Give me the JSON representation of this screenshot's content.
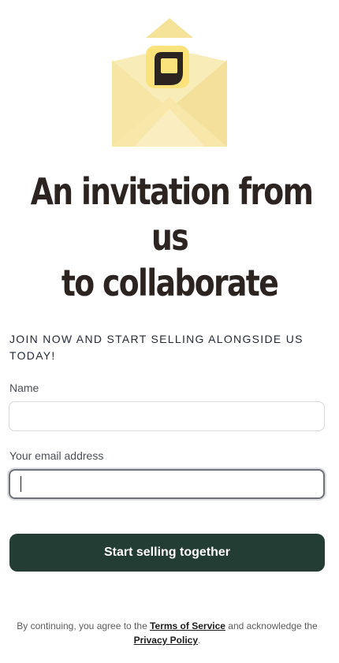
{
  "hero": {
    "icon": "envelope-with-logo-icon",
    "colors": {
      "envelope_light": "#f8eab4",
      "envelope_mid": "#f4e29a",
      "envelope_flap": "#f0dc8c",
      "logo_bg": "#fbe27a",
      "logo_mark": "#2b2421",
      "logo_square": "#fbe27a"
    }
  },
  "headline": {
    "line1": "An invitation from",
    "line2": "us",
    "line3": "to collaborate"
  },
  "subheading": "JOIN NOW AND START SELLING ALONGSIDE US TODAY!",
  "form": {
    "name_label": "Name",
    "name_value": "",
    "name_placeholder": "",
    "email_label": "Your email address",
    "email_value": "",
    "email_placeholder": "",
    "submit_label": "Start selling together"
  },
  "legal": {
    "prefix": "By continuing, you agree to the",
    "terms_link": "Terms of Service",
    "middle": "and acknowledge the",
    "privacy_link": "Privacy Policy",
    "suffix": "."
  },
  "colors": {
    "primary_button": "#243d34",
    "headline_text": "#2b2421",
    "focus_border": "#6f7178"
  }
}
